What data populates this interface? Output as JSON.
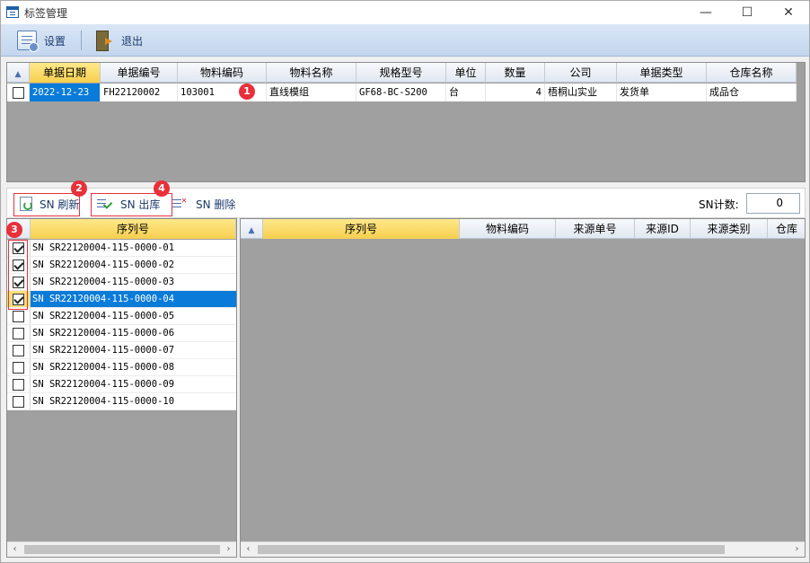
{
  "window": {
    "title": "标签管理",
    "minimize_glyph": "—",
    "maximize_glyph": "☐",
    "close_glyph": "✕"
  },
  "toolbar": {
    "settings_label": "设置",
    "exit_label": "退出"
  },
  "top_grid": {
    "lock_glyph": "🔒",
    "columns": [
      "单据日期",
      "单据编号",
      "物料编码",
      "物料名称",
      "规格型号",
      "单位",
      "数量",
      "公司",
      "单据类型",
      "仓库名称"
    ],
    "rows": [
      {
        "checked": false,
        "date": "2022-12-23",
        "doc_no": "FH22120002",
        "material_code": "103001",
        "material_name": "直线模组",
        "spec": "GF68-BC-S200",
        "unit": "台",
        "qty": "4",
        "company": "梧桐山实业",
        "doc_type": "发货单",
        "warehouse": "成品仓"
      }
    ]
  },
  "sn_toolbar": {
    "refresh_label": "SN 刷新",
    "outbound_label": "SN 出库",
    "delete_label": "SN 删除",
    "count_label": "SN计数:",
    "count_value": "0"
  },
  "badges": [
    "1",
    "2",
    "3",
    "4"
  ],
  "left_grid": {
    "column": "序列号",
    "rows": [
      {
        "checked": true,
        "serial": "SN SR22120004-115-0000-01"
      },
      {
        "checked": true,
        "serial": "SN SR22120004-115-0000-02"
      },
      {
        "checked": true,
        "serial": "SN SR22120004-115-0000-03"
      },
      {
        "checked": true,
        "serial": "SN SR22120004-115-0000-04",
        "selected": true
      },
      {
        "checked": false,
        "serial": "SN SR22120004-115-0000-05"
      },
      {
        "checked": false,
        "serial": "SN SR22120004-115-0000-06"
      },
      {
        "checked": false,
        "serial": "SN SR22120004-115-0000-07"
      },
      {
        "checked": false,
        "serial": "SN SR22120004-115-0000-08"
      },
      {
        "checked": false,
        "serial": "SN SR22120004-115-0000-09"
      },
      {
        "checked": false,
        "serial": "SN SR22120004-115-0000-10"
      }
    ]
  },
  "right_grid": {
    "columns": [
      "序列号",
      "物料编码",
      "来源单号",
      "来源ID",
      "来源类别",
      "仓库"
    ]
  },
  "scroll": {
    "left_glyph": "‹",
    "right_glyph": "›"
  }
}
